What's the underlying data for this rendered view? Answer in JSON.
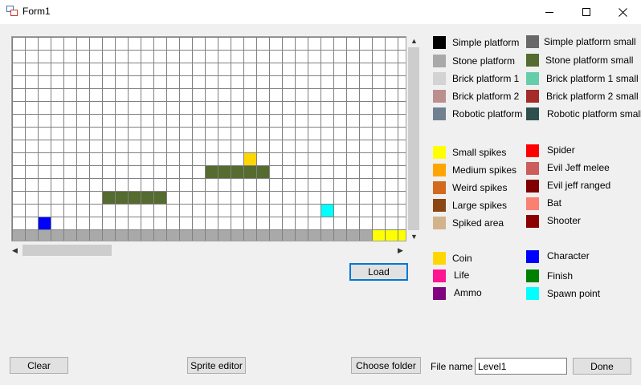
{
  "window": {
    "title": "Form1",
    "controls": [
      "minimize",
      "maximize",
      "close"
    ]
  },
  "canvas": {
    "grid_color": "#808080",
    "background": "#ffffff",
    "tiles": [
      {
        "row": 9,
        "col": 18,
        "color": "#ffd700",
        "type": "Coin"
      },
      {
        "row": 10,
        "col": 15,
        "color": "#556b2f",
        "type": "Stone platform small"
      },
      {
        "row": 10,
        "col": 16,
        "color": "#556b2f",
        "type": "Stone platform small"
      },
      {
        "row": 10,
        "col": 17,
        "color": "#556b2f",
        "type": "Stone platform small"
      },
      {
        "row": 10,
        "col": 18,
        "color": "#556b2f",
        "type": "Stone platform small"
      },
      {
        "row": 10,
        "col": 19,
        "color": "#556b2f",
        "type": "Stone platform small"
      },
      {
        "row": 12,
        "col": 7,
        "color": "#556b2f",
        "type": "Stone platform small"
      },
      {
        "row": 12,
        "col": 8,
        "color": "#556b2f",
        "type": "Stone platform small"
      },
      {
        "row": 12,
        "col": 9,
        "color": "#556b2f",
        "type": "Stone platform small"
      },
      {
        "row": 12,
        "col": 10,
        "color": "#556b2f",
        "type": "Stone platform small"
      },
      {
        "row": 12,
        "col": 11,
        "color": "#556b2f",
        "type": "Stone platform small"
      },
      {
        "row": 13,
        "col": 24,
        "color": "#00ffff",
        "type": "Spawn point"
      },
      {
        "row": 14,
        "col": 2,
        "color": "#0000ff",
        "type": "Character"
      },
      {
        "row": 15,
        "col": 0,
        "span": 28,
        "color": "#a9a9a9",
        "type": "Stone platform"
      },
      {
        "row": 15,
        "col": 28,
        "span": 3,
        "color": "#ffff00",
        "type": "Small spikes"
      }
    ]
  },
  "buttons": {
    "load": "Load",
    "clear": "Clear",
    "sprite_editor": "Sprite editor",
    "choose_folder": "Choose folder",
    "done": "Done"
  },
  "file_name": {
    "label": "File name",
    "value": "Level1"
  },
  "legend": {
    "platforms_left": [
      {
        "label": "Simple platform",
        "color": "#000000"
      },
      {
        "label": "Stone platform",
        "color": "#a9a9a9"
      },
      {
        "label": "Brick platform 1",
        "color": "#d3d3d3"
      },
      {
        "label": "Brick platform 2",
        "color": "#bc8f8f"
      },
      {
        "label": "Robotic platform",
        "color": "#708090"
      }
    ],
    "platforms_right": [
      {
        "label": "Simple platform small",
        "color": "#696969"
      },
      {
        "label": "Stone platform small",
        "color": "#556b2f"
      },
      {
        "label": "Brick platform 1 small",
        "color": "#66cdaa"
      },
      {
        "label": "Brick platform 2 small",
        "color": "#a52a2a"
      },
      {
        "label": "Robotic platform small",
        "color": "#2f4f4f"
      }
    ],
    "hazards_left": [
      {
        "label": "Small spikes",
        "color": "#ffff00"
      },
      {
        "label": "Medium spikes",
        "color": "#ffa500"
      },
      {
        "label": "Weird spikes",
        "color": "#d2691e"
      },
      {
        "label": "Large spikes",
        "color": "#8b4513"
      },
      {
        "label": "Spiked area",
        "color": "#d2b48c"
      }
    ],
    "enemies_right": [
      {
        "label": "Spider",
        "color": "#ff0000"
      },
      {
        "label": "Evil Jeff melee",
        "color": "#cd5c5c"
      },
      {
        "label": "Evil jeff ranged",
        "color": "#800000"
      },
      {
        "label": "Bat",
        "color": "#fa8072"
      },
      {
        "label": "Shooter",
        "color": "#8b0000"
      }
    ],
    "items_left": [
      {
        "label": "Coin",
        "color": "#ffd700"
      },
      {
        "label": "Life",
        "color": "#ff1493"
      },
      {
        "label": "Ammo",
        "color": "#800080"
      }
    ],
    "items_right": [
      {
        "label": "Character",
        "color": "#0000ff"
      },
      {
        "label": "Finish",
        "color": "#008000"
      },
      {
        "label": "Spawn point",
        "color": "#00ffff"
      }
    ]
  }
}
